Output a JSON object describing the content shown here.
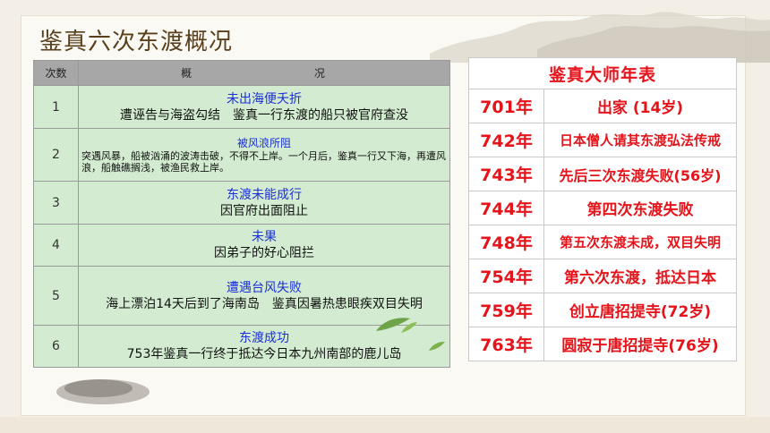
{
  "slide": {
    "title": "鉴真六次东渡概况"
  },
  "left_table": {
    "headers": [
      "次数",
      "概",
      "况"
    ],
    "rows": [
      {
        "num": "1",
        "title": "未出海便夭折",
        "desc": "遭诬告与海盗勾结　鉴真一行东渡的船只被官府查没"
      },
      {
        "num": "2",
        "title": "被风浪所阻",
        "desc": "突遇风暴，船被汹涌的波涛击破，不得不上岸。一个月后，鉴真一行又下海，再遭风浪，船触礁搁浅，被渔民救上岸。"
      },
      {
        "num": "3",
        "title": "东渡未能成行",
        "desc": "因官府出面阻止"
      },
      {
        "num": "4",
        "title": "未果",
        "desc": "因弟子的好心阻拦"
      },
      {
        "num": "5",
        "title": "遭遇台风失败",
        "desc": "海上漂泊14天后到了海南岛　鉴真因暑热患眼疾双目失明"
      },
      {
        "num": "6",
        "title": "东渡成功",
        "desc": "753年鉴真一行终于抵达今日本九州南部的鹿儿岛"
      }
    ]
  },
  "right_table": {
    "title": "鉴真大师年表",
    "rows": [
      {
        "year": "701年",
        "event": "出家 (14岁)"
      },
      {
        "year": "742年",
        "event": "日本僧人请其东渡弘法传戒"
      },
      {
        "year": "743年",
        "event": "先后三次东渡失败(56岁)"
      },
      {
        "year": "744年",
        "event": "第四次东渡失败"
      },
      {
        "year": "748年",
        "event": "第五次东渡未成，双目失明"
      },
      {
        "year": "754年",
        "event": "第六次东渡，抵达日本"
      },
      {
        "year": "759年",
        "event": "创立唐招提寺(72岁)"
      },
      {
        "year": "763年",
        "event": "圆寂于唐招提寺(76岁)"
      }
    ]
  },
  "colors": {
    "title": "#5a3f1c",
    "row_bg": "#d3ecd1",
    "header_bg": "#a7a7a7",
    "blue_title": "#1b2fd6",
    "red_text": "#e5131a"
  }
}
